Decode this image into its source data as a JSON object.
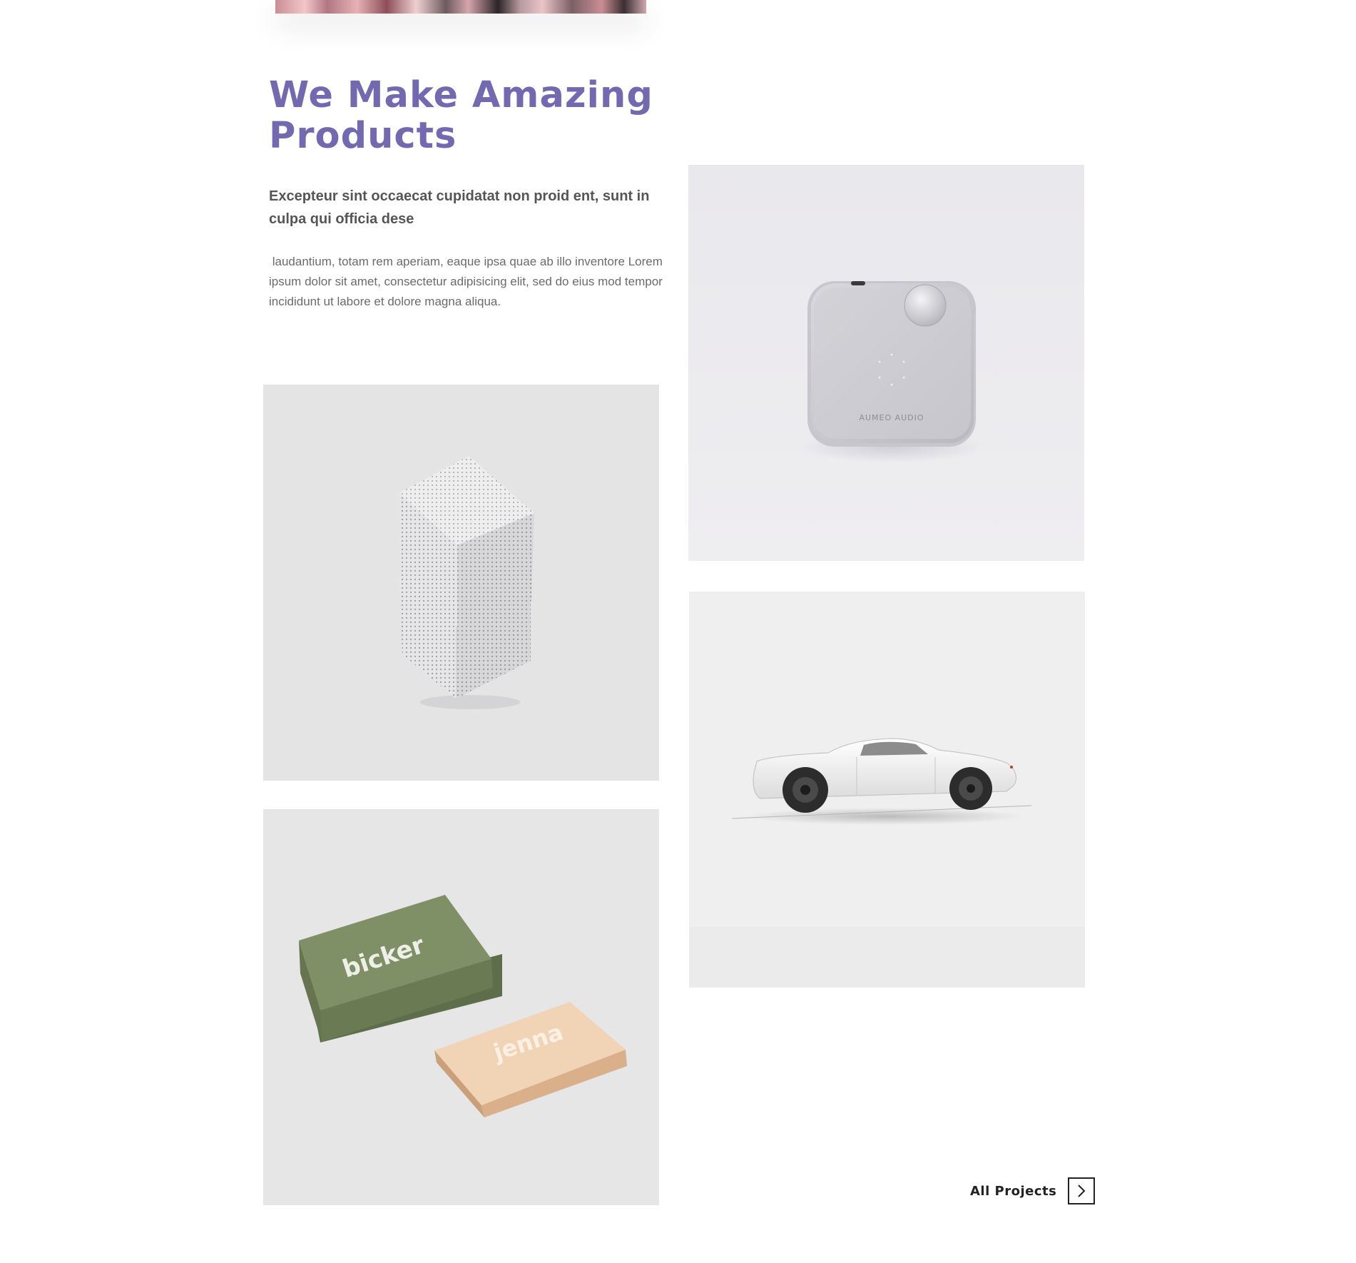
{
  "intro": {
    "heading": "We Make Amazing Products",
    "lead": "Excepteur sint occaecat cupidatat non proid ent, sunt in culpa qui officia dese",
    "body": " laudantium, totam rem aperiam, eaque ipsa quae ab illo inventore Lorem ipsum dolor sit amet, consectetur adipisicing elit, sed do eius mod tempor incididunt ut labore et dolore magna aliqua."
  },
  "gallery": {
    "speaker_brand": "AUMEO AUDIO",
    "card_green_text": "bicker",
    "card_peach_text": "jenna"
  },
  "cta": {
    "label": "All Projects",
    "icon": "chevron-right-icon"
  },
  "colors": {
    "heading": "#7369b0",
    "lead": "#555555",
    "body": "#6b6b6b",
    "card_green": "#7f8f66",
    "card_peach": "#f1d3b5"
  }
}
